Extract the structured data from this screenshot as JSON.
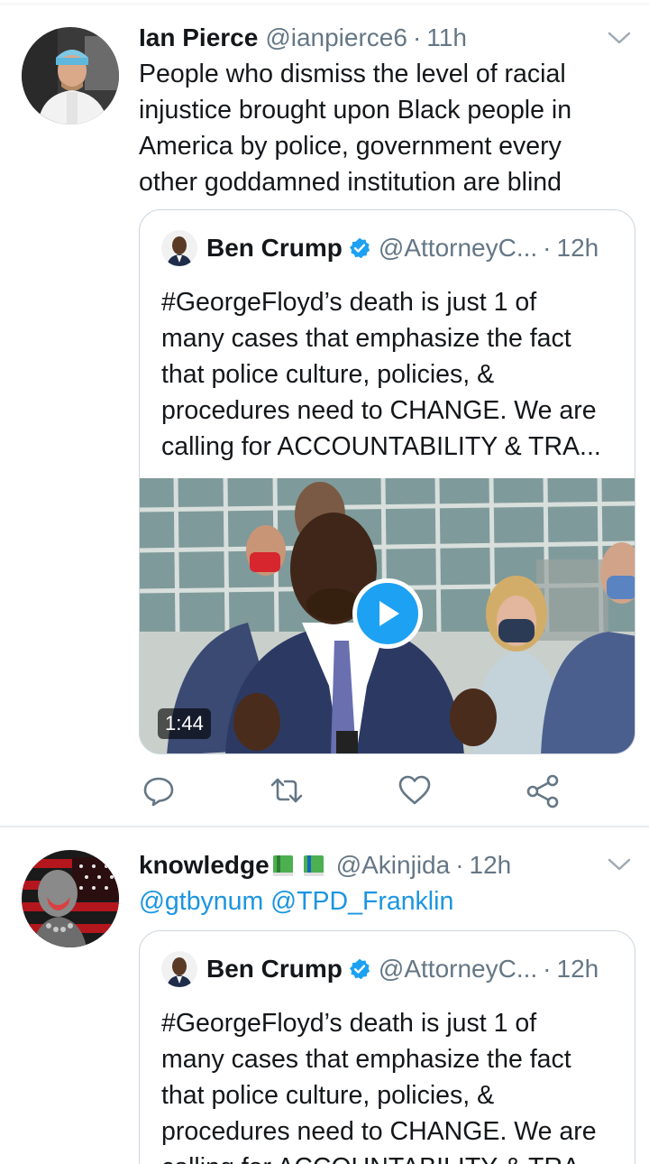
{
  "tweets": [
    {
      "author_name": "Ian Pierce",
      "handle": "@ianpierce6",
      "separator": "·",
      "time": "11h",
      "text_lines": [
        "People who dismiss the level of racial",
        "injustice brought upon Black people in",
        "America by police, government every",
        "other goddamned institution are blind"
      ],
      "quote": {
        "author_name": "Ben Crump",
        "handle": "@AttorneyC...",
        "separator": "·",
        "time": "12h",
        "text_lines": [
          "#GeorgeFloyd’s death is just 1 of",
          "many cases that emphasize the fact",
          "that police culture, policies, &",
          "procedures need to CHANGE. We are",
          "calling for ACCOUNTABILITY & TRA..."
        ],
        "video_duration": "1:44"
      },
      "actions": [
        "reply-icon",
        "retweet-icon",
        "like-icon",
        "share-icon"
      ]
    },
    {
      "author_name": "knowledge",
      "name_emoji": "📗📘",
      "handle": "@Akinjida",
      "separator": "·",
      "time": "12h",
      "mentions": "@gtbynum @TPD_Franklin",
      "quote": {
        "author_name": "Ben Crump",
        "handle": "@AttorneyC...",
        "separator": "·",
        "time": "12h",
        "text_lines": [
          "#GeorgeFloyd’s death is just 1 of",
          "many cases that emphasize the fact",
          "that police culture, policies, &",
          "procedures need to CHANGE. We are",
          "calling for ACCOUNTABILITY & TRA..."
        ]
      }
    }
  ],
  "colors": {
    "link": "#1b95e0",
    "secondary_text": "#657786",
    "verified_badge": "#1da1f2",
    "play_button": "#1da1f2"
  }
}
